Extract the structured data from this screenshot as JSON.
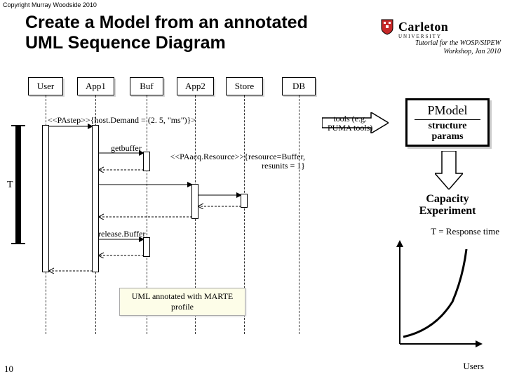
{
  "copyright": "Copyright Murray Woodside 2010",
  "title_line1": "Create a Model from an annotated",
  "title_line2": "UML Sequence Diagram",
  "logo": {
    "name": "Carleton",
    "sub": "UNIVERSITY"
  },
  "tutorial_line1": "Tutorial for the WOSP/SIPEW",
  "tutorial_line2": "Workshop, Jan 2010",
  "participants": [
    "User",
    "App1",
    "Buf",
    "App2",
    "Store",
    "DB"
  ],
  "t_label": "T",
  "messages": {
    "pastep": "<<PAstep>>{host.Demand = (2. 5, \"ms\")}>",
    "getbuffer": "getbuffer",
    "paacq": "<<PAacq.Resource>>{resource=Buffer, resunits = 1}",
    "release": "release.Buffer"
  },
  "annot_box": "UML annotated with MARTE profile",
  "tools_line1": "tools (e.g.",
  "tools_line2": "PUMA tools)",
  "pmodel": {
    "title": "PModel",
    "sub1": "structure",
    "sub2": "params"
  },
  "capacity_line1": "Capacity",
  "capacity_line2": "Experiment",
  "t_response": "T = Response time",
  "users": "Users",
  "slide_num": "10"
}
